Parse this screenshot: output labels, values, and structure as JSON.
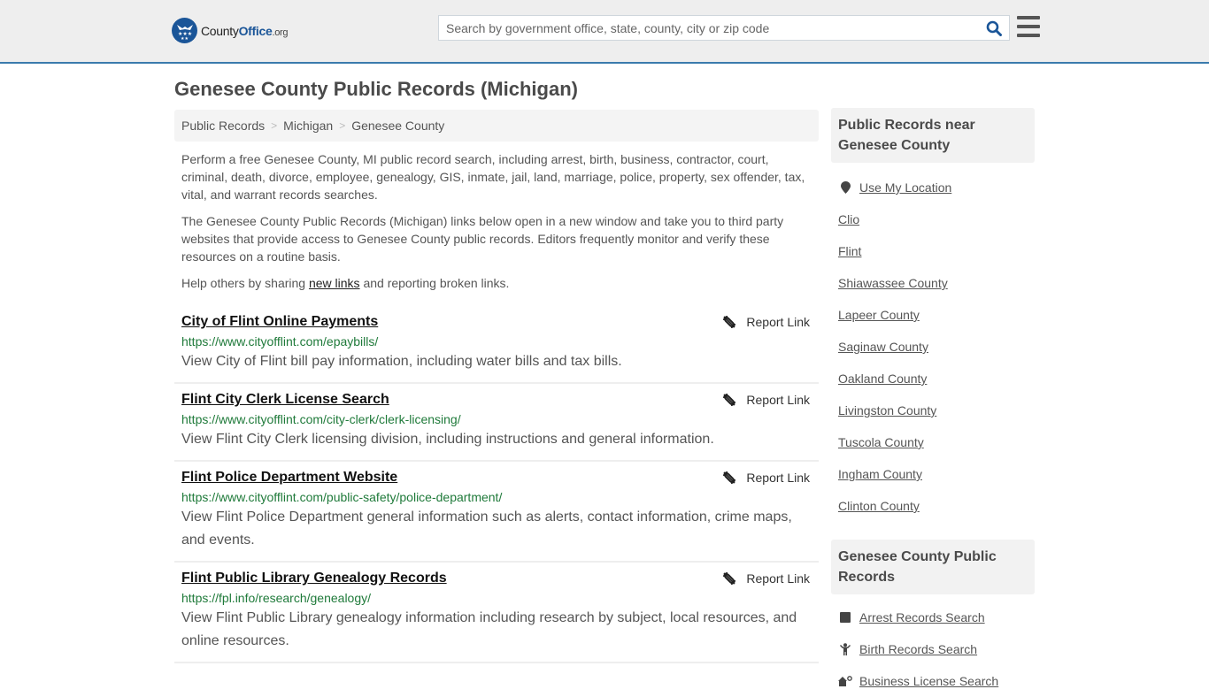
{
  "header": {
    "logo": {
      "brand_prefix": "County",
      "brand_main": "Office",
      "brand_suffix": ".org"
    },
    "search": {
      "placeholder": "Search by government office, state, county, city or zip code",
      "value": ""
    },
    "search_icon": "search-icon",
    "menu_icon": "hamburger-menu-icon"
  },
  "page": {
    "title": "Genesee County Public Records (Michigan)"
  },
  "breadcrumb": [
    {
      "label": "Public Records"
    },
    {
      "label": "Michigan"
    },
    {
      "label": "Genesee County"
    }
  ],
  "breadcrumb_separator": ">",
  "intro": {
    "p1": "Perform a free Genesee County, MI public record search, including arrest, birth, business, contractor, court, criminal, death, divorce, employee, genealogy, GIS, inmate, jail, land, marriage, police, property, sex offender, tax, vital, and warrant records searches.",
    "p2": "The Genesee County Public Records (Michigan) links below open in a new window and take you to third party websites that provide access to Genesee County public records. Editors frequently monitor and verify these resources on a routine basis.",
    "p3_before": "Help others by sharing ",
    "p3_link": "new links",
    "p3_after": " and reporting broken links."
  },
  "records": [
    {
      "title": "City of Flint Online Payments",
      "url": "https://www.cityofflint.com/epaybills/",
      "description": "View City of Flint bill pay information, including water bills and tax bills.",
      "report_label": "Report Link"
    },
    {
      "title": "Flint City Clerk License Search",
      "url": "https://www.cityofflint.com/city-clerk/clerk-licensing/",
      "description": "View Flint City Clerk licensing division, including instructions and general information.",
      "report_label": "Report Link"
    },
    {
      "title": "Flint Police Department Website",
      "url": "https://www.cityofflint.com/public-safety/police-department/",
      "description": "View Flint Police Department general information such as alerts, contact information, crime maps, and events.",
      "report_label": "Report Link"
    },
    {
      "title": "Flint Public Library Genealogy Records",
      "url": "https://fpl.info/research/genealogy/",
      "description": "View Flint Public Library genealogy information including research by subject, local resources, and online resources.",
      "report_label": "Report Link"
    }
  ],
  "sidebar": {
    "nearby": {
      "heading": "Public Records near Genesee County",
      "use_location": "Use My Location",
      "items": [
        "Clio",
        "Flint",
        "Shiawassee County",
        "Lapeer County",
        "Saginaw County",
        "Oakland County",
        "Livingston County",
        "Tuscola County",
        "Ingham County",
        "Clinton County"
      ]
    },
    "categories": {
      "heading": "Genesee County Public Records",
      "items": [
        {
          "label": "Arrest Records Search",
          "icon": "arrest-square-icon"
        },
        {
          "label": "Birth Records Search",
          "icon": "baby-icon"
        },
        {
          "label": "Business License Search",
          "icon": "business-icon"
        }
      ]
    }
  },
  "colors": {
    "brand_blue": "#1a5598",
    "header_border": "#3b7bad",
    "url_green": "#1f7a3a",
    "header_bg": "#eeeeee"
  }
}
